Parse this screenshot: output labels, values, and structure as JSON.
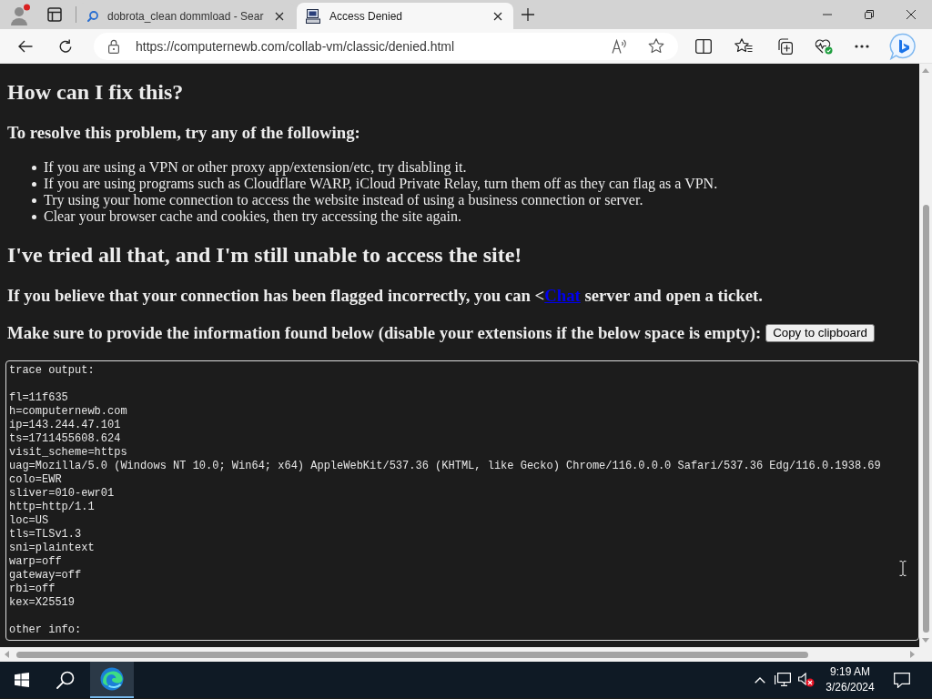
{
  "browser": {
    "tabs": [
      {
        "title": "dobrota_clean dommload - Sear",
        "selected": false
      },
      {
        "title": "Access Denied",
        "selected": true
      }
    ],
    "url": "https://computernewb.com/collab-vm/classic/denied.html"
  },
  "page": {
    "heading": "How can I fix this?",
    "subheading": "To resolve this problem, try any of the following:",
    "tips": [
      "If you are using a VPN or other proxy app/extension/etc, try disabling it.",
      "If you are using programs such as Cloudflare WARP, iCloud Private Relay, turn them off as they can flag as a VPN.",
      "Try using your home connection to access the website instead of using a business connection or server.",
      "Clear your browser cache and cookies, then try accessing the site again."
    ],
    "heading_2": "I've tried all that, and I'm still unable to access the site!",
    "contact": {
      "text_before": "If you believe that your connection has been flagged incorrectly, you can <",
      "link": "Chat",
      "text_after": " server and open a ticket."
    },
    "instruction": "Make sure to provide the information found below (disable your extensions if the below space is empty):",
    "copy_button": "Copy to clipboard",
    "trace_box": {
      "heading": "trace output:",
      "lines": [
        "fl=11f635",
        "h=computernewb.com",
        "ip=143.244.47.101",
        "ts=1711455608.624",
        "visit_scheme=https",
        "uag=Mozilla/5.0 (Windows NT 10.0; Win64; x64) AppleWebKit/537.36 (KHTML, like Gecko) Chrome/116.0.0.0 Safari/537.36 Edg/116.0.1938.69",
        "colo=EWR",
        "sliver=010-ewr01",
        "http=http/1.1",
        "loc=US",
        "tls=TLSv1.3",
        "sni=plaintext",
        "warp=off",
        "gateway=off",
        "rbi=off",
        "kex=X25519"
      ],
      "footer": "other info:"
    }
  },
  "taskbar": {
    "time": "9:19 AM",
    "date": "3/26/2024"
  }
}
